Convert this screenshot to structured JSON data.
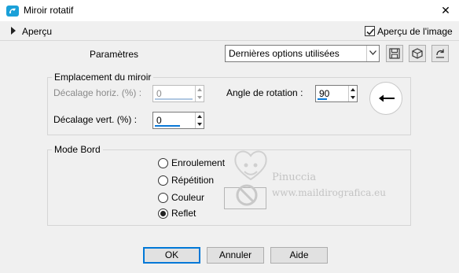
{
  "window": {
    "title": "Miroir rotatif",
    "close_glyph": "✕"
  },
  "apercu": {
    "label": "Aperçu",
    "image_label": "Aperçu de l'image",
    "image_checked": true
  },
  "parametres": {
    "label": "Paramètres",
    "preset_value": "Dernières options utilisées",
    "tool_icons": [
      "save-icon",
      "cube-icon",
      "reset-icon"
    ]
  },
  "emplacement": {
    "title": "Emplacement du miroir",
    "decalage_horiz": {
      "label": "Décalage horiz. (%) :",
      "value": "0",
      "enabled": false
    },
    "decalage_vert": {
      "label": "Décalage vert. (%) :",
      "value": "0",
      "enabled": true
    },
    "angle": {
      "label": "Angle de rotation :",
      "value": "90"
    }
  },
  "mode_bord": {
    "title": "Mode Bord",
    "options": [
      {
        "label": "Enroulement",
        "selected": false
      },
      {
        "label": "Répétition",
        "selected": false
      },
      {
        "label": "Couleur",
        "selected": false
      },
      {
        "label": "Reflet",
        "selected": true
      }
    ]
  },
  "watermark": {
    "line1": "Pinuccia",
    "line2": "www.maildirografica.eu"
  },
  "buttons": {
    "ok": "OK",
    "cancel": "Annuler",
    "help": "Aide"
  },
  "colors": {
    "accent": "#0a78d7",
    "default_button_border": "#0078d7",
    "app_icon": "#1aa0d8",
    "background": "#f0f0f0"
  }
}
